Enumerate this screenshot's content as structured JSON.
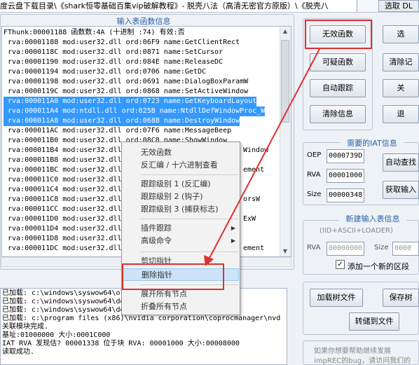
{
  "window": {
    "title": "度云盘下载目录\\《shark恒零基础百集vip破解教程》- 脱壳八法（高清无密官方原版）\\《脱壳八",
    "top_button": "选取 DL"
  },
  "imports_group": {
    "title": "输入表函数信息",
    "rows": [
      "FThunk:00001188 函数数:4A (十进制 :74) 有效:否",
      " rva:00001188 mod:user32.dll ord:06F9 name:GetClientRect",
      " rva:0000118C mod:user32.dll ord:0871 name:SetCursor",
      " rva:00001190 mod:user32.dll ord:084E name:ReleaseDC",
      " rva:00001194 mod:user32.dll ord:0706 name:GetDC",
      " rva:00001198 mod:user32.dll ord:0691 name:DialogBoxParamW",
      " rva:0000119C mod:user32.dll ord:0868 name:SetActiveWindow",
      " rva:000011A0 mod:user32.dll ord:0723 name:GetKeyboardLayout",
      " rva:000011A4 mod:ntdll.dll ord:025B name:NtdllDefWindowProc_W",
      " rva:000011A8 mod:user32.dll ord:068B name:DestroyWindow",
      " rva:000011AC mod:user32.dll ord:07F6 name:MessageBeep",
      " rva:000011B0 mod:user32.dll ord:08C8 name:ShowWindow",
      " rva:000011B4 mod:user32.dll ord:",
      " rva:000011B8 mod:user32.dll ord:",
      " rva:000011BC mod:user32.dll ord:",
      " rva:000011C0 mod:user32.dll ord:",
      " rva:000011C4 mod:user32.dll ord:",
      " rva:000011C8 mod:user32.dll ord:",
      " rva:000011CC mod:user32.dll ord:",
      " rva:000011D0 mod:user32.dll ord:",
      " rva:000011D4 mod:user32.dll ord:",
      " rva:000011D8 mod:user32.dll ord:",
      " rva:000011DC mod:user32.dll ord:"
    ],
    "tails": [
      "Window",
      "",
      "ement",
      "",
      "",
      "orsW",
      "",
      "ExW",
      "",
      "",
      "ement"
    ]
  },
  "log_lines": [
    "已加载: c:\\windows\\syswow64\\ol",
    "已加载: c:\\windows\\syswow64\\de",
    "已加载: c:\\windows\\syswow64\\de",
    "已加载: c:\\program files (x86)\\nvidia corporation\\coprocmanager\\nvd",
    "关联模块完成.",
    "基址:01000000 大小:0001C000",
    "IAT RVA 发现估? 00001338 位于块 RVA: 00001000 大小:00008000",
    "读取成功."
  ],
  "right_buttons": {
    "invalid_fn": "无效函数",
    "suspicious_fn": "可疑函数",
    "auto_trace": "自动跟踪",
    "clear_info": "清除信息",
    "select": "选",
    "clear_record": "清除记",
    "close": "关",
    "exit": "退"
  },
  "iat_info": {
    "title": "需要的IAT信息",
    "oep_label": "OEP",
    "oep_value": "0000739D",
    "rva_label": "RVA",
    "rva_value": "00001000",
    "size_label": "Size",
    "size_value": "00000348",
    "auto_search": "自动查找",
    "get_import": "获取输入"
  },
  "new_import": {
    "title": "新建输入表信息",
    "subtitle": "(IID+ASCII+LOADER)",
    "rva_label": "RVA",
    "rva_placeholder": "00000000",
    "size_label": "Size",
    "size_placeholder": "0000",
    "checkbox_label": "添加一个新的区段",
    "checkbox_mark": "✓"
  },
  "tree_buttons": {
    "load_tree": "加载树文件",
    "save_tree": "保存树",
    "dump_file": "转储到文件"
  },
  "footer": {
    "line1": "如果你想要帮助继续发展",
    "line2": "impREC的bug，请访问我们的"
  },
  "context_menu": {
    "items": [
      "无效函数",
      "反汇编 / 十六进制查看",
      "跟踪级别 1 (反汇编)",
      "跟踪级别 2 (钩子)",
      "跟踪级别 3 (捕获标志)",
      "插件跟踪",
      "高级命令",
      "剪切指针",
      "删除指针",
      "展开所有节点",
      "折叠所有节点"
    ],
    "submenu_arrow": "▶"
  },
  "colors": {
    "selection": "#3399ff",
    "highlight_box": "#e0302f",
    "group_title": "#2e5fa3"
  }
}
